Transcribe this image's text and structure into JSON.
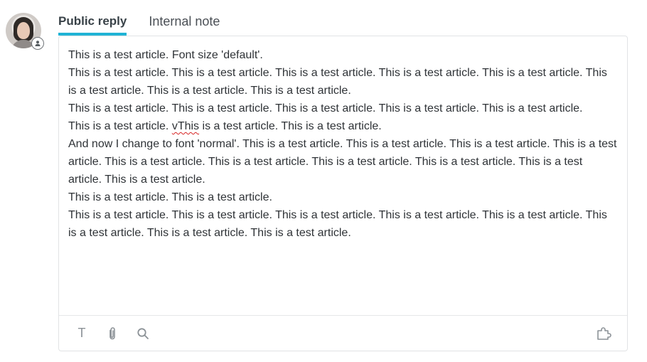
{
  "tabs": [
    {
      "label": "Public reply",
      "active": true
    },
    {
      "label": "Internal note",
      "active": false
    }
  ],
  "editor": {
    "paragraphs": [
      "This is a test article. Font size 'default'.",
      "This is a test article. This is a test article. This is a test article. This is a test article. This is a test article. This is a test article. This is a test article. This is a test article.",
      "This is a test article. This is a test article. This is a test article. This is a test article. This is a test article.",
      {
        "before": "This is a test article. ",
        "misspelled": "vThis",
        "after": " is a test article. This is a test article."
      },
      "And now I change to font 'normal'. This is a test article. This is a test article. This is a test article. This is a test article. This is a test article. This is a test article. This is a test article. This is a test article. This is a test article. This is a test article.",
      "This is a test article. This is a test article.",
      "This is a test article. This is a test article. This is a test article. This is a test article. This is a test article. This is a test article. This is a test article. This is a test article."
    ]
  },
  "toolbar": {
    "text_tool": "T",
    "icons": [
      "text-format-icon",
      "paperclip-icon",
      "search-icon",
      "puzzle-icon"
    ]
  },
  "colors": {
    "accent": "#1fb3d5",
    "text": "#2f3337",
    "tab_text": "#4a4f55",
    "border": "#e1e3e5",
    "icon": "#8c9297"
  }
}
